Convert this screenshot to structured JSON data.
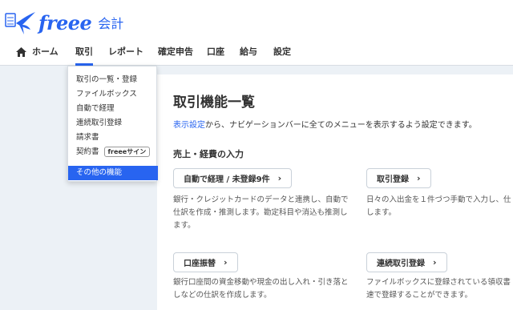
{
  "app": {
    "brand": "freee",
    "product": "会計"
  },
  "nav": {
    "home": "ホーム",
    "items": [
      "取引",
      "レポート",
      "確定申告",
      "口座",
      "給与",
      "設定"
    ]
  },
  "dropdown": {
    "items": [
      "取引の一覧・登録",
      "ファイルボックス",
      "自動で経理",
      "連続取引登録",
      "請求書",
      "契約書"
    ],
    "contract_tag": "freeeサイン",
    "other": "その他の機能"
  },
  "main": {
    "title": "取引機能一覧",
    "desc_link": "表示設定",
    "desc_text": "から、ナビゲーションバーに全てのメニューを表示するよう設定できます。",
    "section": "売上・経費の入力",
    "cards": [
      {
        "label": "自動で経理 / 未登録9件",
        "desc": [
          "銀行・クレジットカードのデータと連携し、自動で",
          "仕訳を作成・推測します。勘定科目や消込も推測し",
          "ます。"
        ]
      },
      {
        "label": "取引登録",
        "desc": [
          "日々の入出金を１件づつ手動で入力し、仕",
          "します。"
        ]
      },
      {
        "label": "口座振替",
        "desc": [
          "銀行口座間の資金移動や現金の出し入れ・引き落と",
          "しなどの仕訳を作成します。"
        ]
      },
      {
        "label": "連続取引登録",
        "desc": [
          "ファイルボックスに登録されている領収書",
          "速で登録することができます。"
        ]
      }
    ]
  },
  "colors": {
    "accent": "#2864f0",
    "background": "#ecf1f6",
    "text": "#323232"
  },
  "icons": {
    "logo": "bird-notebook-icon",
    "home": "home-icon",
    "chevron": "chevron-right-icon"
  }
}
